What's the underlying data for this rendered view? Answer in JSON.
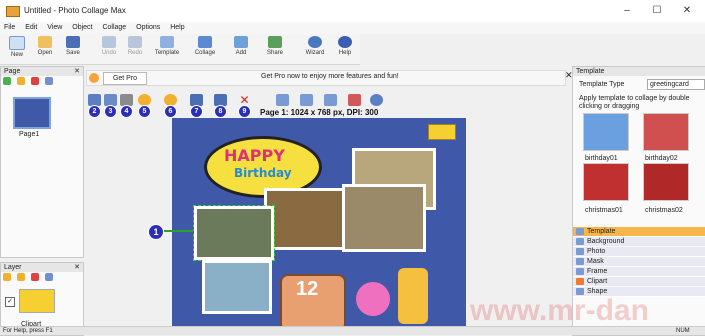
{
  "window": {
    "title": "Untitled - Photo Collage Max",
    "controls": [
      "–",
      "☐",
      "✕"
    ]
  },
  "menu": [
    "File",
    "Edit",
    "View",
    "Object",
    "Collage",
    "Options",
    "Help"
  ],
  "ribbon": [
    {
      "label": "New",
      "icon": "new-doc-icon"
    },
    {
      "label": "Open",
      "icon": "open-folder-icon"
    },
    {
      "label": "Save",
      "icon": "save-icon"
    },
    {
      "label": "Undo",
      "icon": "undo-icon"
    },
    {
      "label": "Redo",
      "icon": "redo-icon"
    },
    {
      "label": "Template",
      "icon": "template-icon"
    },
    {
      "label": "Collage",
      "icon": "collage-icon"
    },
    {
      "label": "Add",
      "icon": "add-image-icon"
    },
    {
      "label": "Share",
      "icon": "share-icon"
    },
    {
      "label": "Wizard",
      "icon": "wizard-icon"
    },
    {
      "label": "Help",
      "icon": "help-icon"
    }
  ],
  "page_panel": {
    "title": "Page",
    "page_label": "Page1"
  },
  "layer_panel": {
    "title": "Layer",
    "item_label": "Clipart"
  },
  "promo": {
    "button": "Get Pro",
    "text": "Get Pro now to enjoy more features and fun!"
  },
  "canvas_info": "Page 1: 1024 x 768 px, DPI: 300",
  "badges": [
    "1",
    "2",
    "3",
    "4",
    "5",
    "6",
    "7",
    "8",
    "9"
  ],
  "canvas_text": {
    "happy": "HAPPY",
    "birthday": "Birthday",
    "number": "12"
  },
  "template_panel": {
    "title": "Template",
    "type_label": "Template Type",
    "type_value": "greetingcard",
    "hint": "Apply template to collage by double clicking or dragging",
    "thumbnails": [
      "birthday01",
      "birthday02",
      "christmas01",
      "christmas02"
    ],
    "categories": [
      "Template",
      "Background",
      "Photo",
      "Mask",
      "Frame",
      "Clipart",
      "Shape"
    ]
  },
  "status": {
    "left": "For Help, press F1",
    "right": "NUM"
  },
  "watermark": "www.mr-dan",
  "colors": {
    "canvas": "#3f58a8",
    "accent": "#f7b64a",
    "badge": "#2b2fb8"
  }
}
